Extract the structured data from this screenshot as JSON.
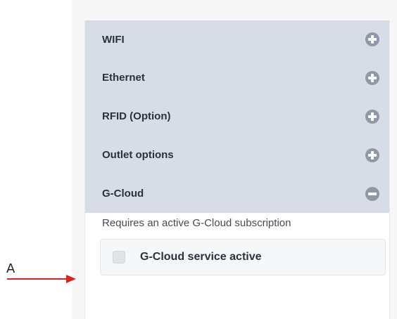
{
  "accordion": {
    "items": [
      {
        "label": "WIFI",
        "state": "collapsed",
        "icon": "plus-circle-icon"
      },
      {
        "label": "Ethernet",
        "state": "collapsed",
        "icon": "plus-circle-icon"
      },
      {
        "label": "RFID (Option)",
        "state": "collapsed",
        "icon": "plus-circle-icon"
      },
      {
        "label": "Outlet options",
        "state": "collapsed",
        "icon": "plus-circle-icon"
      },
      {
        "label": "G-Cloud",
        "state": "expanded",
        "icon": "minus-circle-icon"
      }
    ]
  },
  "gcloud": {
    "requirement_text": "Requires an active G-Cloud subscription",
    "checkbox_label": "G-Cloud service active",
    "checked": false
  },
  "annotation": {
    "letter": "A",
    "arrow_color": "#e0201b"
  },
  "colors": {
    "header_bg": "#d7dce6",
    "icon_color": "#8f98a8",
    "text_dark": "#2c323c"
  }
}
